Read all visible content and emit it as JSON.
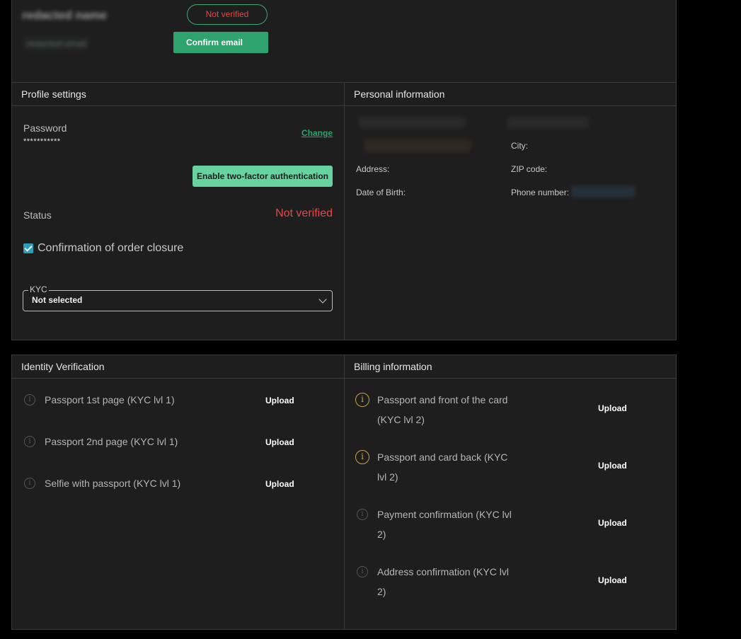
{
  "header": {
    "user_name": "redacted name",
    "user_email": "redacted email",
    "verification_status": "Not verified",
    "confirm_email_label": "Confirm email"
  },
  "profile_settings": {
    "title": "Profile settings",
    "password_label": "Password",
    "password_value": "***********",
    "change_label": "Change",
    "twofa_label": "Enable two-factor authentication",
    "status_label": "Status",
    "status_value": "Not verified",
    "order_closure_label": "Confirmation of order closure",
    "order_closure_checked": true,
    "kyc_legend": "KYC",
    "kyc_value": "Not selected"
  },
  "personal_information": {
    "title": "Personal information",
    "city_label": "City:",
    "zip_label": "ZIP code:",
    "address_label": "Address:",
    "dob_label": "Date of Birth:",
    "phone_label": "Phone number:"
  },
  "identity_verification": {
    "title": "Identity Verification",
    "items": [
      {
        "label": "Passport 1st page (KYC lvl 1)",
        "action": "Upload"
      },
      {
        "label": "Passport 2nd page (KYC lvl 1)",
        "action": "Upload"
      },
      {
        "label": "Selfie with passport (KYC lvl 1)",
        "action": "Upload"
      }
    ]
  },
  "billing_information": {
    "title": "Billing information",
    "items": [
      {
        "line1": "Passport and front of the card",
        "line2": "(KYC lvl 2)",
        "action": "Upload"
      },
      {
        "line1": "Passport and card back (KYC",
        "line2": "lvl 2)",
        "action": "Upload"
      },
      {
        "line1": "Payment confirmation (KYC lvl",
        "line2": "2)",
        "action": "Upload"
      },
      {
        "line1": "Address confirmation (KYC lvl",
        "line2": "2)",
        "action": "Upload"
      }
    ]
  },
  "colors": {
    "accent_green": "#2ea36e",
    "light_green": "#67d3a1",
    "error_red": "#e24a4a",
    "warning_gold": "#c9a24a",
    "panel_bg": "#1e1e1e"
  }
}
